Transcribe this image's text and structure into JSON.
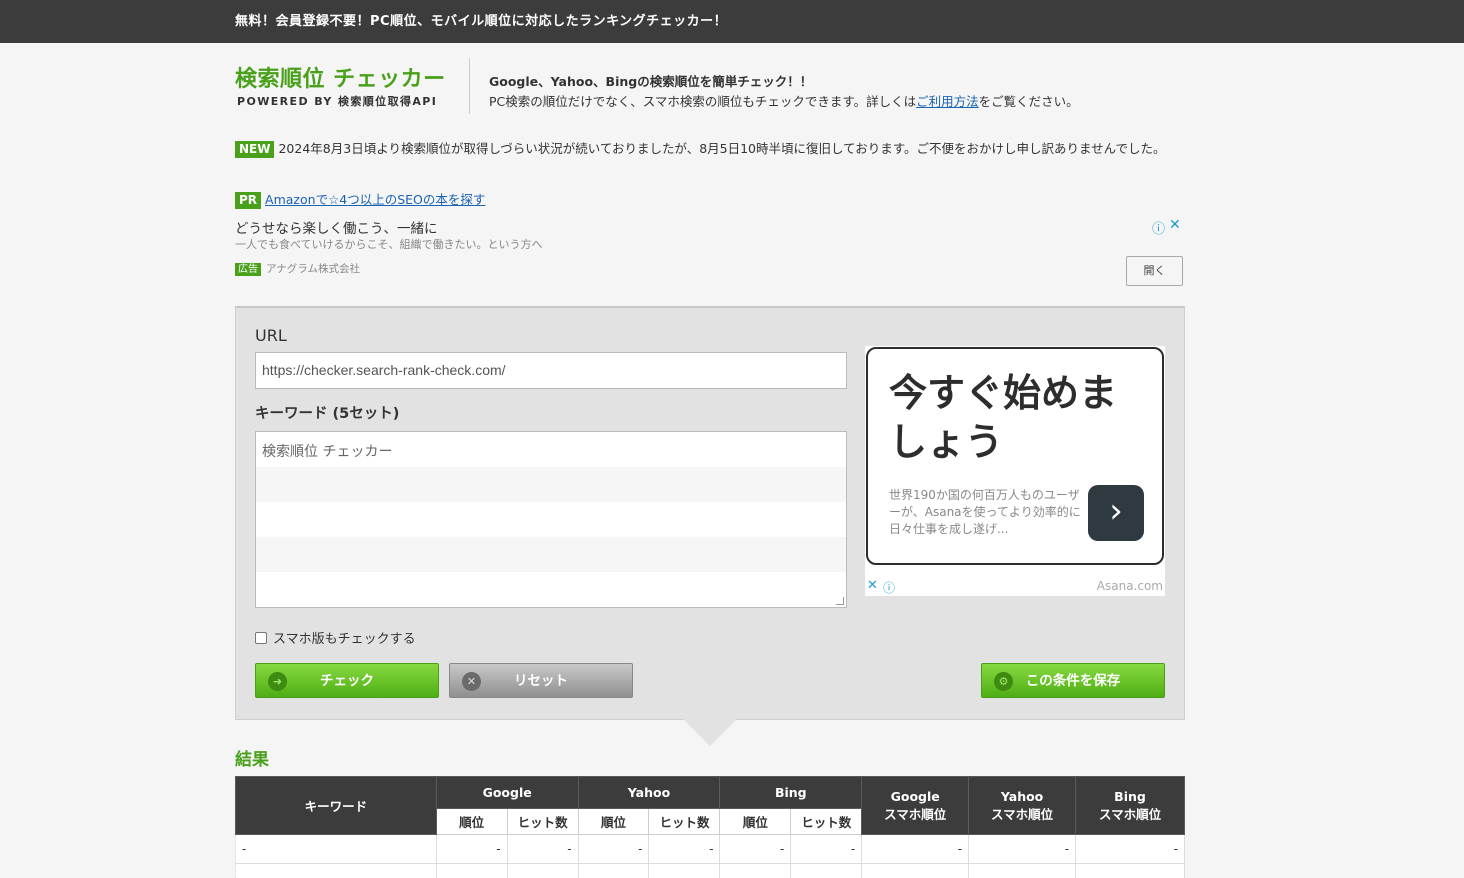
{
  "topbar": {
    "text": "無料！会員登録不要！PC順位、モバイル順位に対応したランキングチェッカー！"
  },
  "logo": {
    "title": "検索順位 チェッカー",
    "subtitle": "POWERED BY 検索順位取得API"
  },
  "description": {
    "line1": "Google、Yahoo、Bingの検索順位を簡単チェック！！",
    "line2_prefix": "PC検索の順位だけでなく、スマホ検索の順位もチェックできます。詳しくは",
    "line2_link": "ご利用方法",
    "line2_suffix": "をご覧ください。"
  },
  "notice": {
    "badge": "NEW",
    "text": "2024年8月3日頃より検索順位が取得しづらい状況が続いておりましたが、8月5日10時半頃に復旧しております。ご不便をおかけし申し訳ありませんでした。"
  },
  "pr": {
    "badge": "PR",
    "link": "Amazonで☆4つ以上のSEOの本を探す"
  },
  "text_ad": {
    "title": "どうせなら楽しく働こう、一緒に",
    "subtitle": "一人でも食べていけるからこそ、組織で働きたい。という方へ",
    "label_badge": "広告",
    "advertiser": "アナグラム株式会社",
    "info_icon": "ⓘ",
    "close_icon": "✕",
    "open_button": "開く"
  },
  "form": {
    "url_label": "URL",
    "url_value": "https://checker.search-rank-check.com/",
    "keyword_label": "キーワード (5セット)",
    "keywords": [
      "検索順位 チェッカー",
      "",
      "",
      "",
      ""
    ],
    "mobile_check_label": "スマホ版もチェックする",
    "check_button": "チェック",
    "reset_button": "リセット",
    "save_button": "この条件を保存"
  },
  "side_ad": {
    "headline": "今すぐ始めましょう",
    "body": "世界190か国の何百万人ものユーザーが、Asanaを使ってより効率的に日々仕事を成し遂げ...",
    "arrow": "›",
    "close_icon": "✕",
    "info_icon": "ⓘ",
    "domain": "Asana.com"
  },
  "results": {
    "title": "結果",
    "headers": {
      "keyword": "キーワード",
      "google": "Google",
      "yahoo": "Yahoo",
      "bing": "Bing",
      "rank": "順位",
      "hits": "ヒット数",
      "google_mobile": [
        "Google",
        "スマホ順位"
      ],
      "yahoo_mobile": [
        "Yahoo",
        "スマホ順位"
      ],
      "bing_mobile": [
        "Bing",
        "スマホ順位"
      ]
    },
    "rows": [
      {
        "keyword": "-",
        "cells": [
          "-",
          "-",
          "-",
          "-",
          "-",
          "-",
          "-",
          "-",
          "-"
        ]
      }
    ]
  },
  "colors": {
    "brand_green": "#49a01a",
    "topbar": "#3c3c3c",
    "link": "#1a62b4"
  }
}
